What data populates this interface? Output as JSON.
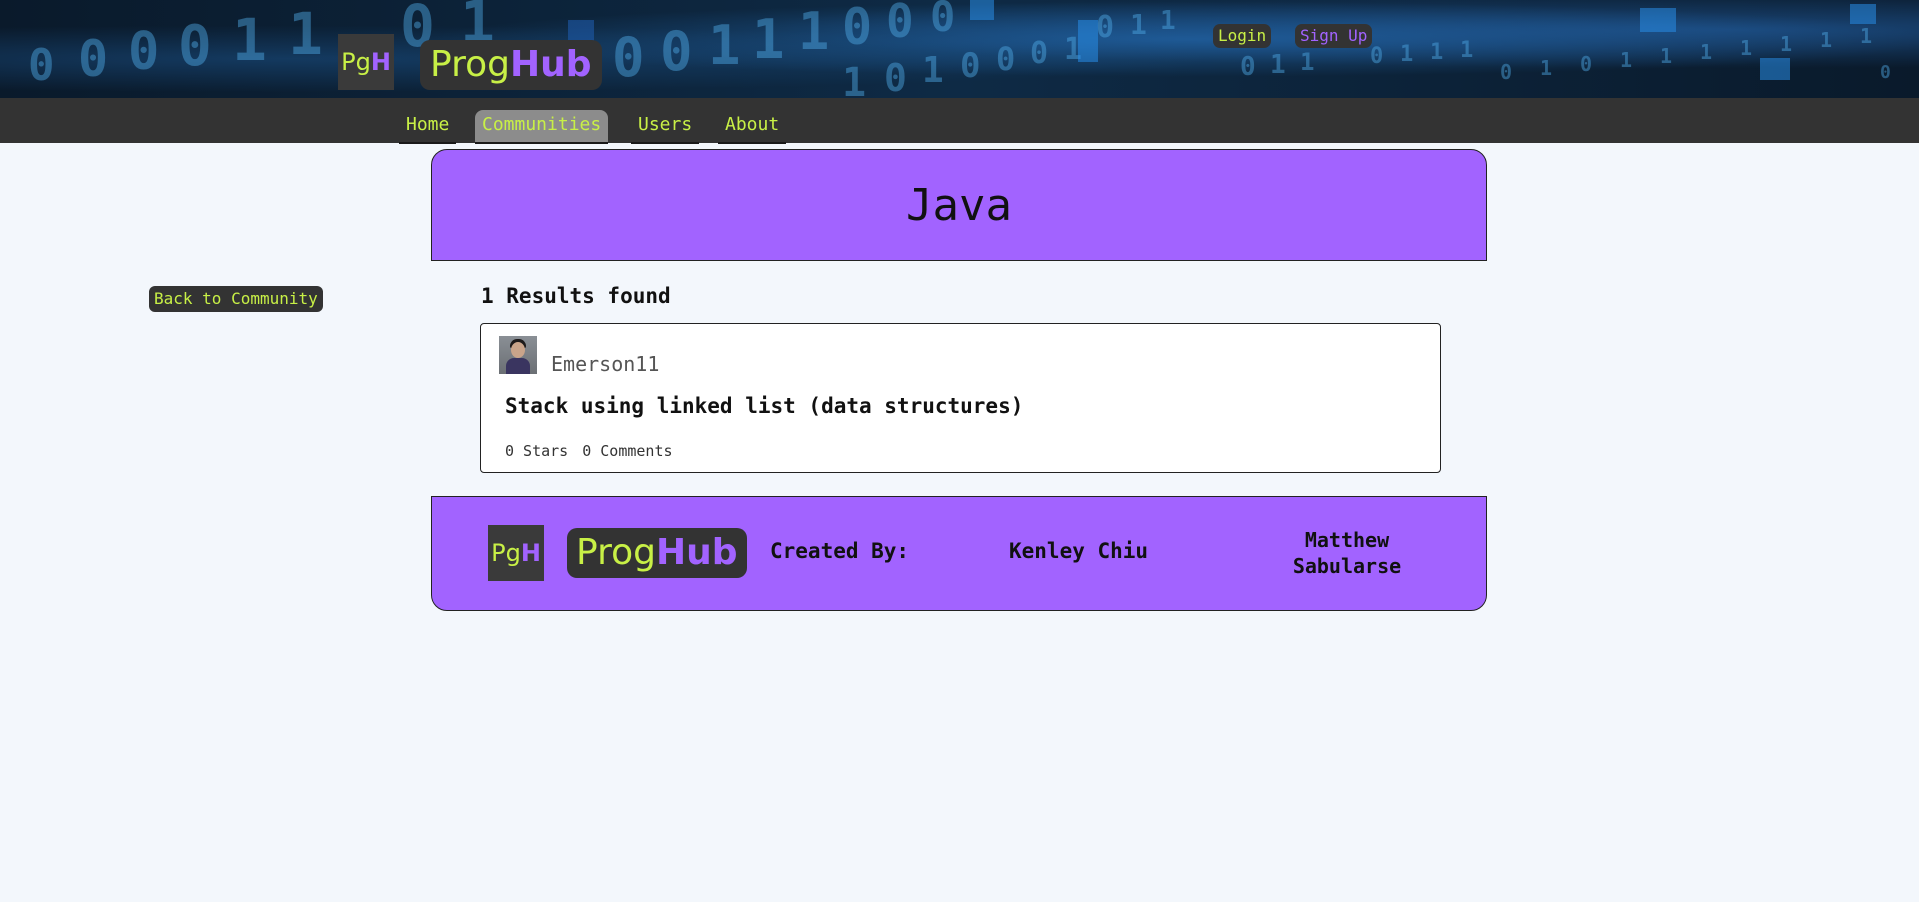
{
  "header": {
    "logo_short_a": "Pg",
    "logo_short_b": "H",
    "logo_long_a": "Prog",
    "logo_long_b": "Hub",
    "login_label": "Login",
    "signup_label": "Sign Up",
    "binary_text": "0011100010111010011000"
  },
  "nav": {
    "items": [
      {
        "label": "Home"
      },
      {
        "label": "Communities"
      },
      {
        "label": "Users"
      },
      {
        "label": "About"
      }
    ],
    "active": "Communities"
  },
  "community": {
    "title": "Java",
    "back_label": "Back to Community",
    "results_label": "1 Results found"
  },
  "posts": [
    {
      "author": "Emerson11",
      "title": "Stack using linked list (data structures)",
      "stars": "0 Stars",
      "comments": "0 Comments"
    }
  ],
  "footer": {
    "logo_short_a": "Pg",
    "logo_short_b": "H",
    "logo_long_a": "Prog",
    "logo_long_b": "Hub",
    "created_by": "Created By:",
    "author1": "Kenley Chiu",
    "author2": "Matthew Sabularse"
  },
  "colors": {
    "accent_green": "#c8f046",
    "accent_purple": "#a263ff",
    "dark": "#333333",
    "background": "#f3f7fc"
  }
}
